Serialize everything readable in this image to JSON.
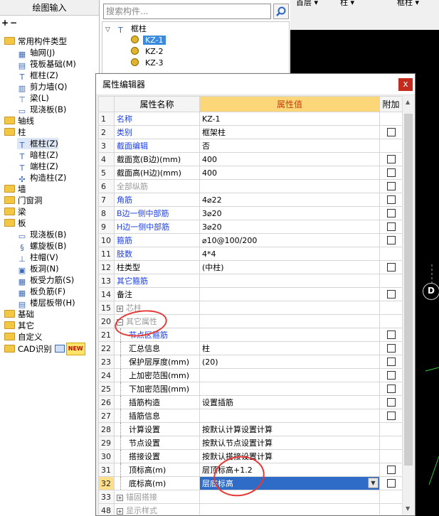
{
  "left_panel": {
    "title": "绘图输入",
    "tree": [
      {
        "label": "常用构件类型",
        "level": 0,
        "kind": "folder",
        "expanded": true
      },
      {
        "label": "轴网(J)",
        "level": 1,
        "kind": "item",
        "icon": "grid-icon"
      },
      {
        "label": "筏板基础(M)",
        "level": 1,
        "kind": "item",
        "icon": "raft-icon"
      },
      {
        "label": "框柱(Z)",
        "level": 1,
        "kind": "item",
        "icon": "column-icon"
      },
      {
        "label": "剪力墙(Q)",
        "level": 1,
        "kind": "item",
        "icon": "wall-icon"
      },
      {
        "label": "梁(L)",
        "level": 1,
        "kind": "item",
        "icon": "beam-icon"
      },
      {
        "label": "现浇板(B)",
        "level": 1,
        "kind": "item",
        "icon": "slab-icon"
      },
      {
        "label": "轴线",
        "level": 0,
        "kind": "folder"
      },
      {
        "label": "柱",
        "level": 0,
        "kind": "folder",
        "expanded": true
      },
      {
        "label": "框柱(Z)",
        "level": 1,
        "kind": "item",
        "icon": "column-icon",
        "selected": true
      },
      {
        "label": "暗柱(Z)",
        "level": 1,
        "kind": "item",
        "icon": "column-icon"
      },
      {
        "label": "端柱(Z)",
        "level": 1,
        "kind": "item",
        "icon": "column-icon"
      },
      {
        "label": "构造柱(Z)",
        "level": 1,
        "kind": "item",
        "icon": "construct-column-icon"
      },
      {
        "label": "墙",
        "level": 0,
        "kind": "folder"
      },
      {
        "label": "门窗洞",
        "level": 0,
        "kind": "folder"
      },
      {
        "label": "梁",
        "level": 0,
        "kind": "folder"
      },
      {
        "label": "板",
        "level": 0,
        "kind": "folder",
        "expanded": true
      },
      {
        "label": "现浇板(B)",
        "level": 1,
        "kind": "item",
        "icon": "slab-icon"
      },
      {
        "label": "螺旋板(B)",
        "level": 1,
        "kind": "item",
        "icon": "spiral-icon"
      },
      {
        "label": "柱帽(V)",
        "level": 1,
        "kind": "item",
        "icon": "cap-icon"
      },
      {
        "label": "板洞(N)",
        "level": 1,
        "kind": "item",
        "icon": "hole-icon"
      },
      {
        "label": "板受力筋(S)",
        "level": 1,
        "kind": "item",
        "icon": "rebar-icon"
      },
      {
        "label": "板负筋(F)",
        "level": 1,
        "kind": "item",
        "icon": "rebar-icon"
      },
      {
        "label": "楼层板带(H)",
        "level": 1,
        "kind": "item",
        "icon": "band-icon"
      },
      {
        "label": "基础",
        "level": 0,
        "kind": "folder"
      },
      {
        "label": "其它",
        "level": 0,
        "kind": "folder"
      },
      {
        "label": "自定义",
        "level": 0,
        "kind": "folder"
      },
      {
        "label": "CAD识别",
        "level": 0,
        "kind": "folder",
        "badge": "NEW"
      }
    ]
  },
  "middle_panel": {
    "search_placeholder": "搜索构件...",
    "tree_root": "框柱",
    "items": [
      "KZ-1",
      "KZ-2",
      "KZ-3"
    ]
  },
  "right_panel": {
    "dropdowns": [
      "首层",
      "柱",
      "框柱"
    ],
    "canvas_marker": "D"
  },
  "dialog": {
    "title": "属性编辑器",
    "columns": {
      "name": "属性名称",
      "value": "属性值",
      "extra": "附加"
    },
    "rows": [
      {
        "num": "1",
        "name": "名称",
        "value": "KZ-1",
        "style": "blue",
        "check": false
      },
      {
        "num": "2",
        "name": "类别",
        "value": "框架柱",
        "style": "blue",
        "check": true
      },
      {
        "num": "3",
        "name": "截面编辑",
        "value": "否",
        "style": "blue",
        "check": false
      },
      {
        "num": "4",
        "name": "截面宽(B边)(mm)",
        "value": "400",
        "style": "normal",
        "check": true
      },
      {
        "num": "5",
        "name": "截面高(H边)(mm)",
        "value": "400",
        "style": "normal",
        "check": true
      },
      {
        "num": "6",
        "name": "全部纵筋",
        "value": "",
        "style": "gray",
        "check": true
      },
      {
        "num": "7",
        "name": "角筋",
        "value": "4⌀22",
        "style": "blue",
        "check": true
      },
      {
        "num": "8",
        "name": "B边一侧中部筋",
        "value": "3⌀20",
        "style": "blue",
        "check": true
      },
      {
        "num": "9",
        "name": "H边一侧中部筋",
        "value": "3⌀20",
        "style": "blue",
        "check": true
      },
      {
        "num": "10",
        "name": "箍筋",
        "value": "⌀10@100/200",
        "style": "blue",
        "check": true
      },
      {
        "num": "11",
        "name": "肢数",
        "value": "4*4",
        "style": "blue",
        "check": false
      },
      {
        "num": "12",
        "name": "柱类型",
        "value": "(中柱)",
        "style": "normal",
        "check": true
      },
      {
        "num": "13",
        "name": "其它箍筋",
        "value": "",
        "style": "blue",
        "check": false
      },
      {
        "num": "14",
        "name": "备注",
        "value": "",
        "style": "normal",
        "check": true
      },
      {
        "num": "15",
        "name": "芯柱",
        "value": "",
        "style": "gray",
        "check": false,
        "group": "plus"
      },
      {
        "num": "20",
        "name": "其它属性",
        "value": "",
        "style": "gray",
        "check": false,
        "group": "minus"
      },
      {
        "num": "21",
        "name": "节点区箍筋",
        "value": "",
        "style": "blue",
        "check": true,
        "indent": true
      },
      {
        "num": "22",
        "name": "汇总信息",
        "value": "柱",
        "style": "normal",
        "check": true,
        "indent": true
      },
      {
        "num": "23",
        "name": "保护层厚度(mm)",
        "value": "(20)",
        "style": "normal",
        "check": true,
        "indent": true
      },
      {
        "num": "24",
        "name": "上加密范围(mm)",
        "value": "",
        "style": "normal",
        "check": true,
        "indent": true
      },
      {
        "num": "25",
        "name": "下加密范围(mm)",
        "value": "",
        "style": "normal",
        "check": true,
        "indent": true
      },
      {
        "num": "26",
        "name": "插筋构造",
        "value": "设置插筋",
        "style": "normal",
        "check": true,
        "indent": true
      },
      {
        "num": "27",
        "name": "插筋信息",
        "value": "",
        "style": "normal",
        "check": true,
        "indent": true
      },
      {
        "num": "28",
        "name": "计算设置",
        "value": "按默认计算设置计算",
        "style": "normal",
        "check": false,
        "indent": true
      },
      {
        "num": "29",
        "name": "节点设置",
        "value": "按默认节点设置计算",
        "style": "normal",
        "check": false,
        "indent": true
      },
      {
        "num": "30",
        "name": "搭接设置",
        "value": "按默认搭接设置计算",
        "style": "normal",
        "check": false,
        "indent": true
      },
      {
        "num": "31",
        "name": "顶标高(m)",
        "value": "层顶标高+1.2",
        "style": "normal",
        "check": true,
        "indent": true
      },
      {
        "num": "32",
        "name": "底标高(m)",
        "value": "层底标高",
        "style": "normal",
        "check": true,
        "indent": true,
        "editing": true
      },
      {
        "num": "33",
        "name": "锚固搭接",
        "value": "",
        "style": "gray",
        "check": false,
        "group": "plus"
      },
      {
        "num": "48",
        "name": "显示样式",
        "value": "",
        "style": "gray",
        "check": false,
        "group": "plus"
      }
    ]
  }
}
